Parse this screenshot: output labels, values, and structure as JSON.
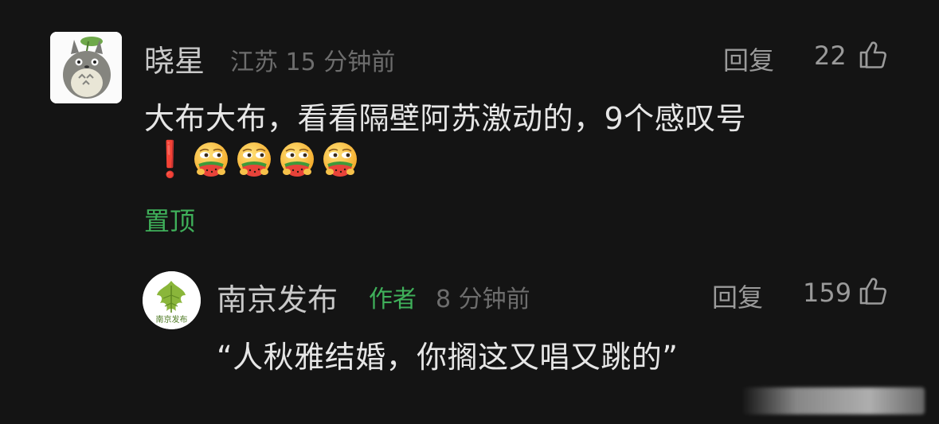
{
  "comment": {
    "user_name": "晓星",
    "location_time": "江苏 15 分钟前",
    "reply_label": "回复",
    "like_count": "22",
    "text": "大布大布，看看隔壁阿苏激动的，9个感叹号",
    "exclaim_emoji": "❗",
    "emoji_icon": "drooling-watermelon-face-emoji",
    "emoji_count": 4,
    "pinned_label": "置顶"
  },
  "reply": {
    "user_name": "南京发布",
    "author_tag": "作者",
    "time": "8 分钟前",
    "reply_label": "回复",
    "like_count": "159",
    "text": "“人秋雅结婚，你搁这又唱又跳的”",
    "avatar_text": "南京发布"
  },
  "colors": {
    "background": "#141414",
    "accent_green": "#3fb05a",
    "exclaim_red": "#e0202a"
  },
  "icons": {
    "like": "thumbs-up-icon"
  }
}
